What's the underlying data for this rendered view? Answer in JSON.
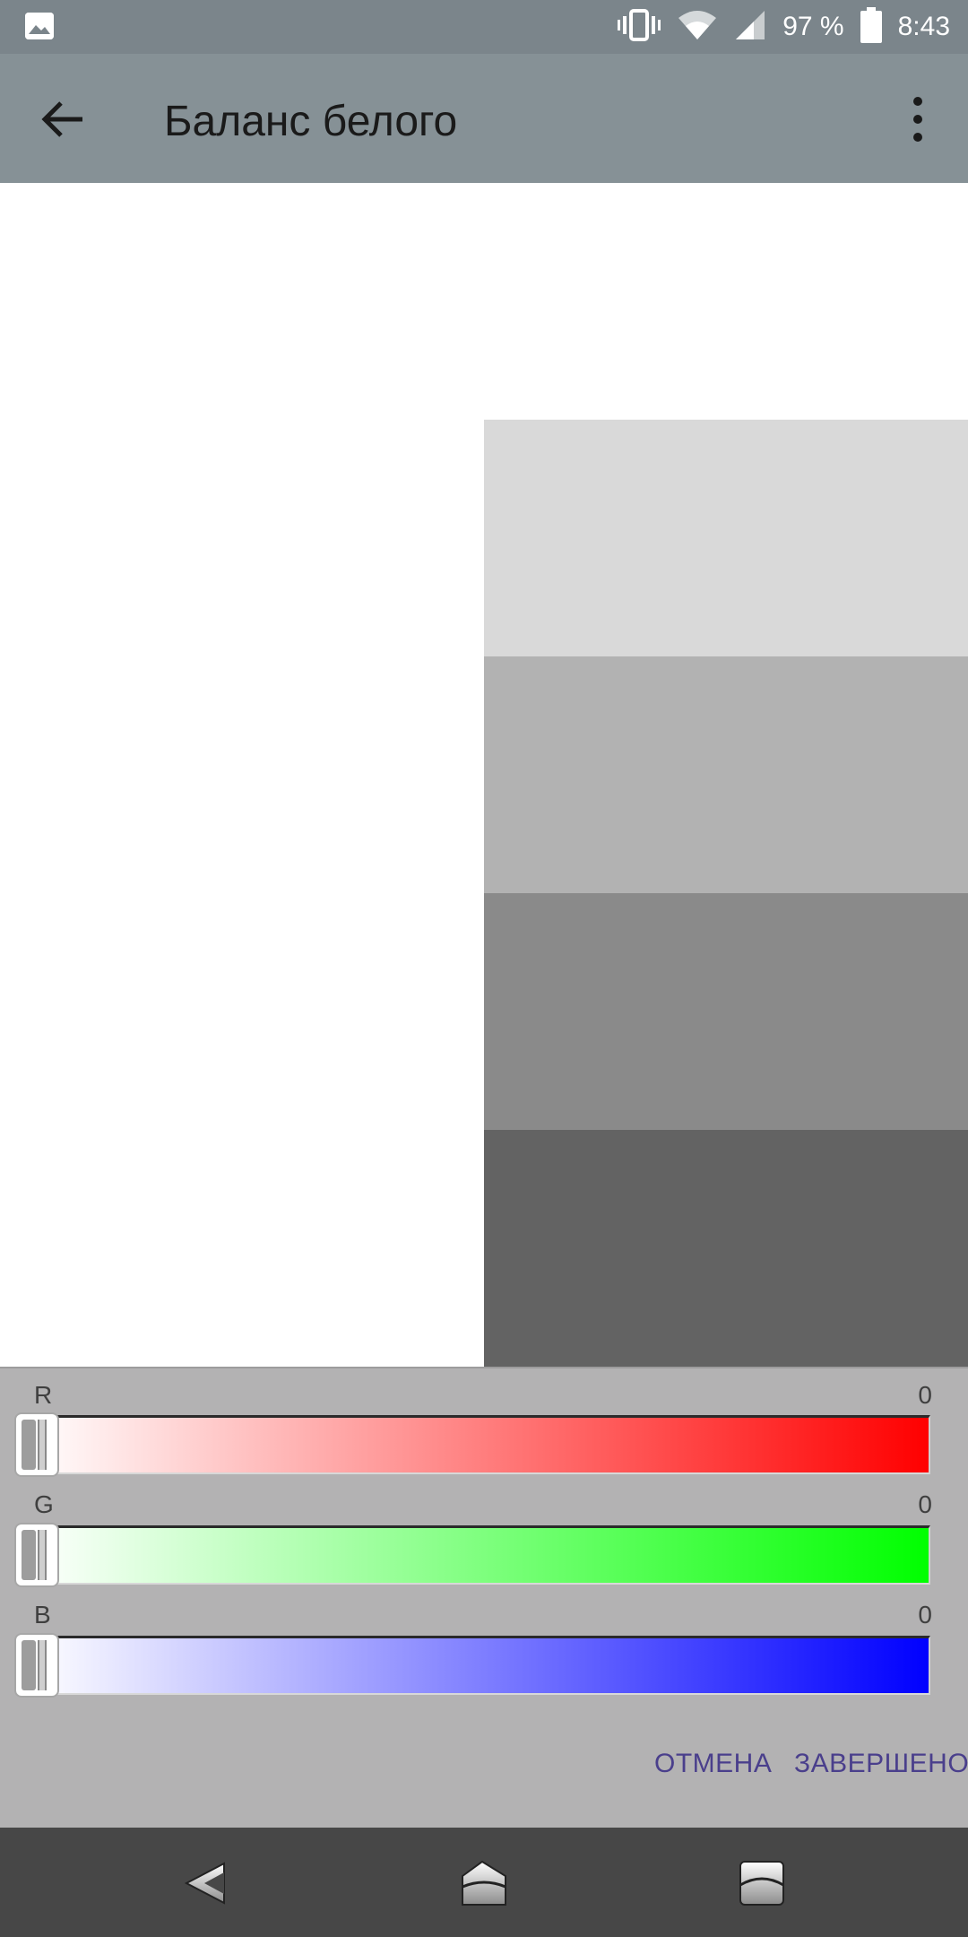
{
  "status_bar": {
    "battery_percent": "97 %",
    "time": "8:43",
    "icons": [
      "gallery-icon",
      "vibrate-icon",
      "wifi-icon",
      "signal-icon",
      "battery-icon"
    ]
  },
  "app_bar": {
    "title": "Баланс белого",
    "back_icon": "arrow-back-icon",
    "menu_icon": "more-vert-icon"
  },
  "preview": {
    "swatch_colors": [
      "#d9d9d9",
      "#b2b2b2",
      "#8a8a8a",
      "#636363"
    ]
  },
  "channels": [
    {
      "label": "R",
      "value": "0",
      "color": "#ff0000"
    },
    {
      "label": "G",
      "value": "0",
      "color": "#00ff00"
    },
    {
      "label": "B",
      "value": "0",
      "color": "#0000ff"
    }
  ],
  "actions": {
    "cancel": "ОТМЕНА",
    "done": "ЗАВЕРШЕНО"
  },
  "nav_bar": {
    "icons": [
      "nav-back-icon",
      "nav-home-icon",
      "nav-recents-icon"
    ]
  }
}
